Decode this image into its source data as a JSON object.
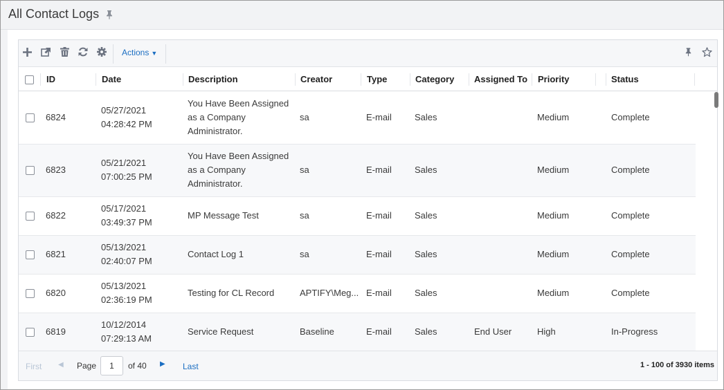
{
  "header": {
    "title": "All Contact Logs",
    "pin_icon": "pin-icon"
  },
  "toolbar": {
    "icons": [
      "add-icon",
      "open-external-icon",
      "delete-icon",
      "refresh-icon",
      "settings-icon"
    ],
    "actions_label": "Actions",
    "right_icons": [
      "pin-icon",
      "star-icon"
    ]
  },
  "table": {
    "columns": [
      "ID",
      "Date",
      "Description",
      "Creator",
      "Type",
      "Category",
      "Assigned To",
      "Priority",
      "Status"
    ],
    "rows": [
      {
        "id": "6824",
        "date": "05/27/2021",
        "time": "04:28:42 PM",
        "description": [
          "You Have Been Assigned",
          "as a Company",
          "Administrator."
        ],
        "creator": "sa",
        "type": "E-mail",
        "category": "Sales",
        "assigned_to": "",
        "priority": "Medium",
        "status": "Complete"
      },
      {
        "id": "6823",
        "date": "05/21/2021",
        "time": "07:00:25 PM",
        "description": [
          "You Have Been Assigned",
          "as a Company",
          "Administrator."
        ],
        "creator": "sa",
        "type": "E-mail",
        "category": "Sales",
        "assigned_to": "",
        "priority": "Medium",
        "status": "Complete"
      },
      {
        "id": "6822",
        "date": "05/17/2021",
        "time": "03:49:37 PM",
        "description": [
          "MP Message Test"
        ],
        "creator": "sa",
        "type": "E-mail",
        "category": "Sales",
        "assigned_to": "",
        "priority": "Medium",
        "status": "Complete"
      },
      {
        "id": "6821",
        "date": "05/13/2021",
        "time": "02:40:07 PM",
        "description": [
          "Contact Log 1"
        ],
        "creator": "sa",
        "type": "E-mail",
        "category": "Sales",
        "assigned_to": "",
        "priority": "Medium",
        "status": "Complete"
      },
      {
        "id": "6820",
        "date": "05/13/2021",
        "time": "02:36:19 PM",
        "description": [
          "Testing for CL Record"
        ],
        "creator": "APTIFY\\Meg...",
        "type": "E-mail",
        "category": "Sales",
        "assigned_to": "",
        "priority": "Medium",
        "status": "Complete"
      },
      {
        "id": "6819",
        "date": "10/12/2014",
        "time": "07:29:13 AM",
        "description": [
          "Service Request"
        ],
        "creator": "Baseline",
        "type": "E-mail",
        "category": "Sales",
        "assigned_to": "End User",
        "priority": "High",
        "status": "In-Progress"
      }
    ]
  },
  "pager": {
    "first_label": "First",
    "page_label": "Page",
    "current_page": "1",
    "of_label": "of 40",
    "last_label": "Last",
    "info": "1 - 100 of 3930 items"
  },
  "colors": {
    "accent": "#1b6ec2",
    "disabled": "#b9c6d6",
    "icon": "#6b7280"
  }
}
